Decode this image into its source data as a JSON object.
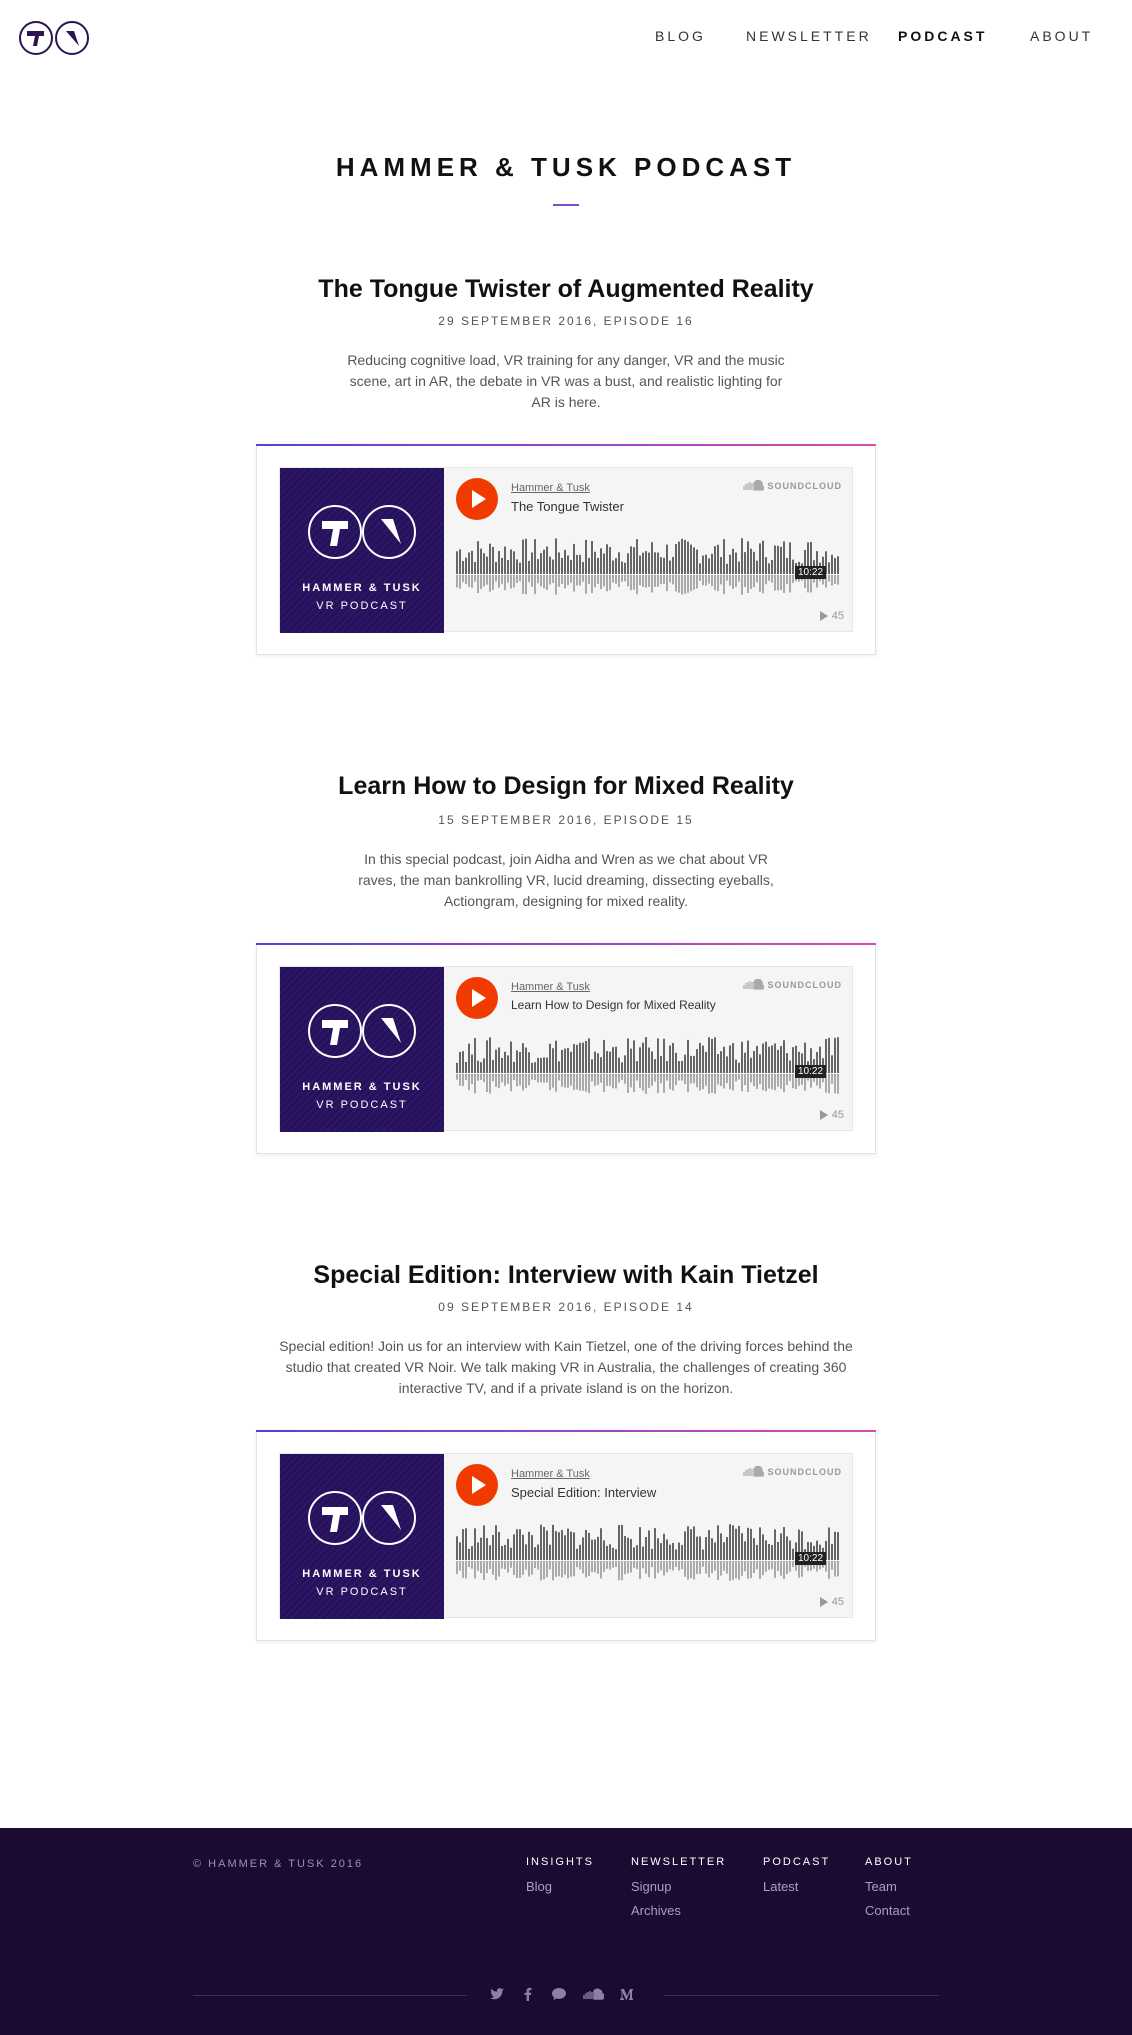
{
  "nav": {
    "items": [
      {
        "label": "BLOG"
      },
      {
        "label": "NEWSLETTER"
      },
      {
        "label": "PODCAST"
      },
      {
        "label": "ABOUT"
      }
    ]
  },
  "page_title": "HAMMER & TUSK PODCAST",
  "episodes": [
    {
      "title": "The Tongue Twister of Augmented Reality",
      "meta": "29 SEPTEMBER 2016, EPISODE 16",
      "description": "Reducing cognitive load, VR training for any danger, VR and the music scene, art in AR, the debate in VR was a bust, and realistic lighting for AR is here.",
      "player": {
        "user": "Hammer & Tusk",
        "track": "The Tongue Twister",
        "duration": "10:22",
        "plays": "45",
        "provider": "SOUNDCLOUD",
        "art_line1": "HAMMER & TUSK",
        "art_line2": "VR PODCAST"
      }
    },
    {
      "title": "Learn How to Design for Mixed Reality",
      "meta": "15 SEPTEMBER 2016, EPISODE 15",
      "description": "In this special podcast, join Aidha and Wren as we chat about VR raves, the man bankrolling VR, lucid dreaming, dissecting eyeballs, Actiongram, designing for mixed reality.",
      "player": {
        "user": "Hammer & Tusk",
        "track": "Learn How to Design for Mixed Reality",
        "duration": "10:22",
        "plays": "45",
        "provider": "SOUNDCLOUD",
        "art_line1": "HAMMER & TUSK",
        "art_line2": "VR PODCAST"
      }
    },
    {
      "title": "Special Edition: Interview with Kain Tietzel",
      "meta": "09 SEPTEMBER 2016, EPISODE 14",
      "description": "Special edition! Join us for an interview with Kain Tietzel, one of the driving forces behind the studio that created VR Noir. We talk making VR in Australia, the challenges of creating 360 interactive TV, and if a private island is on the horizon.",
      "player": {
        "user": "Hammer & Tusk",
        "track": "Special Edition: Interview",
        "duration": "10:22",
        "plays": "45",
        "provider": "SOUNDCLOUD",
        "art_line1": "HAMMER & TUSK",
        "art_line2": "VR PODCAST"
      }
    }
  ],
  "footer": {
    "copyright": "© HAMMER & TUSK 2016",
    "columns": [
      {
        "heading": "INSIGHTS",
        "links": [
          "Blog"
        ]
      },
      {
        "heading": "NEWSLETTER",
        "links": [
          "Signup",
          "Archives"
        ]
      },
      {
        "heading": "PODCAST",
        "links": [
          "Latest"
        ]
      },
      {
        "heading": "ABOUT",
        "links": [
          "Team",
          "Contact"
        ]
      }
    ],
    "social_icons": [
      "twitter-icon",
      "facebook-icon",
      "chat-icon",
      "soundcloud-icon",
      "medium-icon"
    ]
  },
  "colors": {
    "brand_purple": "#1b0b32",
    "accent_purple": "#7b4fcf",
    "soundcloud_orange": "#f13a00"
  }
}
